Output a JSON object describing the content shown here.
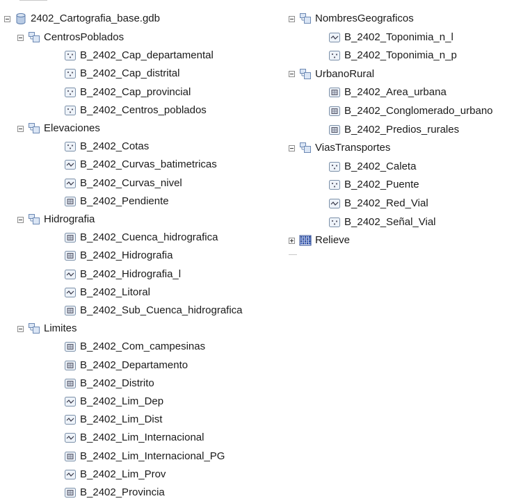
{
  "catalog_tree": {
    "root": {
      "label": "2402_Cartografia_base.gdb",
      "icon": "geodatabase-icon"
    },
    "left_column": [
      {
        "kind": "dataset",
        "label": "CentrosPoblados",
        "expanded": true
      },
      {
        "kind": "item",
        "label": "B_2402_Cap_departamental",
        "icon": "point-feature-class-icon"
      },
      {
        "kind": "item",
        "label": "B_2402_Cap_distrital",
        "icon": "point-feature-class-icon"
      },
      {
        "kind": "item",
        "label": "B_2402_Cap_provincial",
        "icon": "point-feature-class-icon"
      },
      {
        "kind": "item",
        "label": "B_2402_Centros_poblados",
        "icon": "point-feature-class-icon"
      },
      {
        "kind": "dataset",
        "label": "Elevaciones",
        "expanded": true
      },
      {
        "kind": "item",
        "label": "B_2402_Cotas",
        "icon": "point-feature-class-icon"
      },
      {
        "kind": "item",
        "label": "B_2402_Curvas_batimetricas",
        "icon": "line-feature-class-icon"
      },
      {
        "kind": "item",
        "label": "B_2402_Curvas_nivel",
        "icon": "line-feature-class-icon"
      },
      {
        "kind": "item",
        "label": "B_2402_Pendiente",
        "icon": "polygon-feature-class-icon"
      },
      {
        "kind": "dataset",
        "label": "Hidrografia",
        "expanded": true
      },
      {
        "kind": "item",
        "label": "B_2402_Cuenca_hidrografica",
        "icon": "polygon-feature-class-icon"
      },
      {
        "kind": "item",
        "label": "B_2402_Hidrografia",
        "icon": "polygon-feature-class-icon"
      },
      {
        "kind": "item",
        "label": "B_2402_Hidrografia_l",
        "icon": "line-feature-class-icon"
      },
      {
        "kind": "item",
        "label": "B_2402_Litoral",
        "icon": "line-feature-class-icon"
      },
      {
        "kind": "item",
        "label": "B_2402_Sub_Cuenca_hidrografica",
        "icon": "polygon-feature-class-icon"
      },
      {
        "kind": "dataset",
        "label": "Limites",
        "expanded": true
      },
      {
        "kind": "item",
        "label": "B_2402_Com_campesinas",
        "icon": "polygon-feature-class-icon"
      },
      {
        "kind": "item",
        "label": "B_2402_Departamento",
        "icon": "polygon-feature-class-icon"
      },
      {
        "kind": "item",
        "label": "B_2402_Distrito",
        "icon": "polygon-feature-class-icon"
      },
      {
        "kind": "item",
        "label": "B_2402_Lim_Dep",
        "icon": "line-feature-class-icon"
      },
      {
        "kind": "item",
        "label": "B_2402_Lim_Dist",
        "icon": "line-feature-class-icon"
      },
      {
        "kind": "item",
        "label": "B_2402_Lim_Internacional",
        "icon": "line-feature-class-icon"
      },
      {
        "kind": "item",
        "label": "B_2402_Lim_Internacional_PG",
        "icon": "polygon-feature-class-icon"
      },
      {
        "kind": "item",
        "label": "B_2402_Lim_Prov",
        "icon": "line-feature-class-icon"
      },
      {
        "kind": "item",
        "label": "B_2402_Provincia",
        "icon": "polygon-feature-class-icon"
      }
    ],
    "right_column": [
      {
        "kind": "dataset",
        "label": "NombresGeograficos",
        "expanded": true
      },
      {
        "kind": "item",
        "label": "B_2402_Toponimia_n_l",
        "icon": "line-feature-class-icon"
      },
      {
        "kind": "item",
        "label": "B_2402_Toponimia_n_p",
        "icon": "point-feature-class-icon"
      },
      {
        "kind": "dataset",
        "label": "UrbanoRural",
        "expanded": true
      },
      {
        "kind": "item",
        "label": "B_2402_Area_urbana",
        "icon": "polygon-feature-class-icon"
      },
      {
        "kind": "item",
        "label": "B_2402_Conglomerado_urbano",
        "icon": "polygon-feature-class-icon"
      },
      {
        "kind": "item",
        "label": "B_2402_Predios_rurales",
        "icon": "polygon-feature-class-icon"
      },
      {
        "kind": "dataset",
        "label": "ViasTransportes",
        "expanded": true
      },
      {
        "kind": "item",
        "label": "B_2402_Caleta",
        "icon": "point-feature-class-icon"
      },
      {
        "kind": "item",
        "label": "B_2402_Puente",
        "icon": "point-feature-class-icon"
      },
      {
        "kind": "item",
        "label": "B_2402_Red_Vial",
        "icon": "line-feature-class-icon"
      },
      {
        "kind": "item",
        "label": "B_2402_Señal_Vial",
        "icon": "point-feature-class-icon"
      },
      {
        "kind": "raster",
        "label": "Relieve",
        "icon": "raster-dataset-icon",
        "expanded": false
      }
    ]
  },
  "colors": {
    "dataset_icon_border": "#6b88b3",
    "dataset_icon_fill": "#dbe6f5",
    "geodatabase_icon": "#5f7fae",
    "feature_icon_border": "#7a8fa8",
    "feature_icon_fill": "#eef3f9"
  }
}
